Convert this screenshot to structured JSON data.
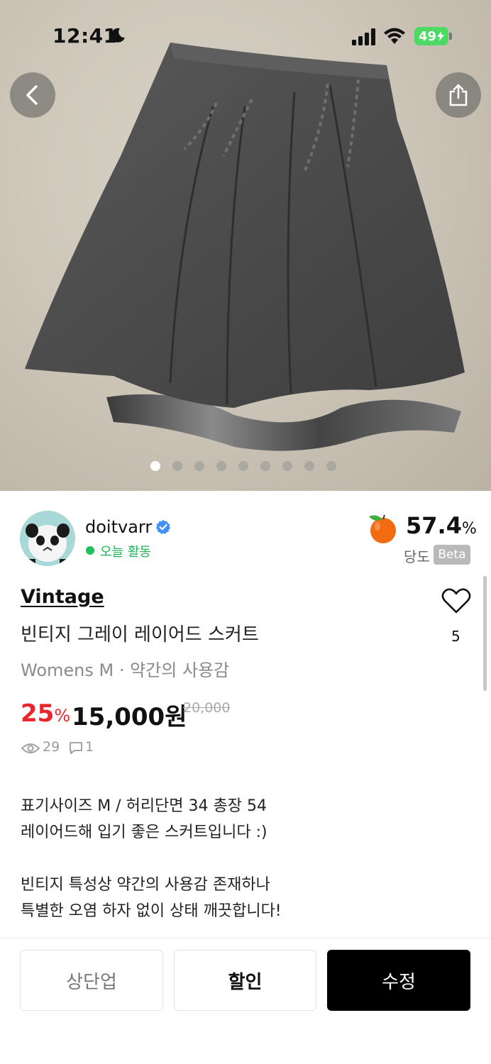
{
  "status": {
    "time": "12:41",
    "battery": "49"
  },
  "gallery": {
    "total": 9,
    "current": 1
  },
  "seller": {
    "name": "doitvarr",
    "activity": "오늘 활동"
  },
  "sweetness": {
    "value": "57.4",
    "unit": "%",
    "label": "당도",
    "badge": "Beta"
  },
  "product": {
    "brand": "Vintage",
    "title": "빈티지 그레이 레이어드 스커트",
    "meta": "Womens M · 약간의 사용감",
    "discount": "25",
    "discount_unit": "%",
    "price": "15,000원",
    "original_price": "20,000",
    "views": "29",
    "chats": "1",
    "likes": "5",
    "description": [
      "표기사이즈 M / 허리단면 34 총장 54",
      "레이어드해 입기 좋은 스커트입니다 :)",
      "",
      "빈티지 특성상 약간의 사용감 존재하나",
      "특별한 오염 하자 없이 상태 깨끗합니다!"
    ]
  },
  "actions": {
    "bump": "상단업",
    "discount": "할인",
    "edit": "수정"
  },
  "colors": {
    "accent_red": "#e8262c",
    "online_green": "#20b457",
    "verified_blue": "#3f8ff7",
    "primary_button": "#000000"
  }
}
